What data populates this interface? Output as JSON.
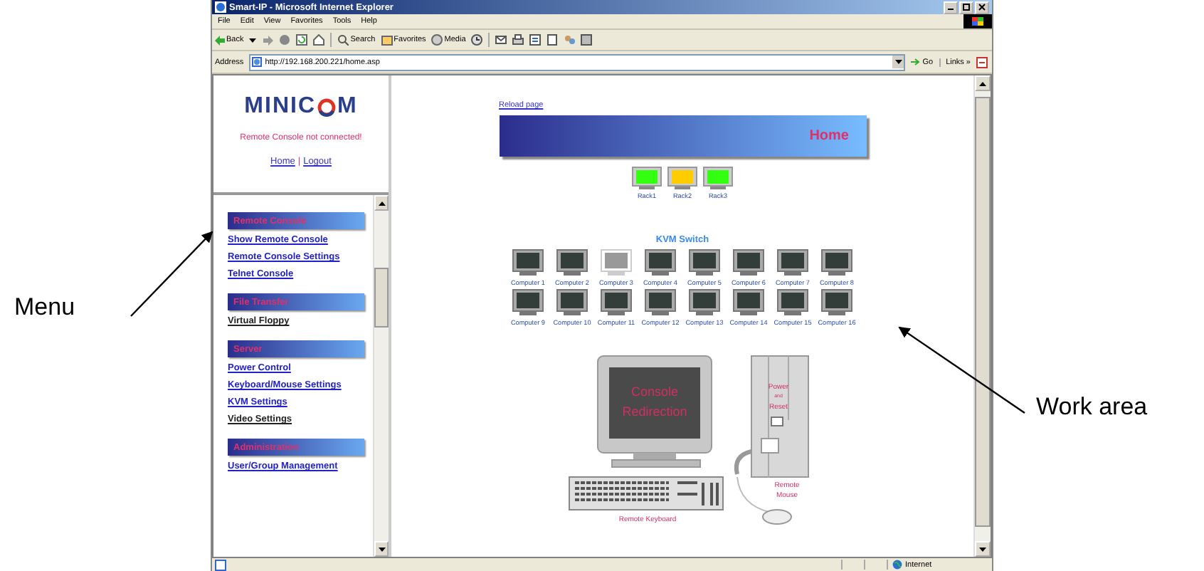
{
  "annotations": [
    {
      "text": "Menu"
    },
    {
      "text": "Work area"
    }
  ],
  "window": {
    "title": "Smart-IP - Microsoft Internet Explorer",
    "menu_bar": [
      "File",
      "Edit",
      "View",
      "Favorites",
      "Tools",
      "Help"
    ],
    "toolbar": {
      "back": "Back",
      "search": "Search",
      "favorites": "Favorites",
      "media": "Media"
    },
    "address_label": "Address",
    "url": "http://192.168.200.221/home.asp",
    "go": "Go",
    "links": "Links",
    "links_chevron": "»"
  },
  "left_frame": {
    "logo_start": "MINIC",
    "logo_end": "M",
    "connection_status": "Remote Console not connected!",
    "home_link": "Home",
    "separator": "|",
    "logout_link": "Logout",
    "sections": [
      {
        "title": "Remote Console",
        "items": [
          {
            "label": "Show Remote Console",
            "visited": false
          },
          {
            "label": "Remote Console Settings",
            "visited": false
          },
          {
            "label": "Telnet Console",
            "visited": false
          }
        ]
      },
      {
        "title": "File Transfer",
        "items": [
          {
            "label": "Virtual Floppy",
            "visited": true
          }
        ]
      },
      {
        "title": "Server",
        "items": [
          {
            "label": "Power Control",
            "visited": false
          },
          {
            "label": "Keyboard/Mouse Settings",
            "visited": false
          },
          {
            "label": "KVM Settings",
            "visited": false
          },
          {
            "label": "Video Settings",
            "visited": true
          }
        ]
      },
      {
        "title": "Administration",
        "items": [
          {
            "label": "User/Group Management",
            "visited": false
          }
        ]
      }
    ]
  },
  "work_area": {
    "reload_link": "Reload page",
    "banner_title": "Home",
    "racks": [
      {
        "label": "Rack1",
        "color": "#33ff11"
      },
      {
        "label": "Rack2",
        "color": "#ffcc00"
      },
      {
        "label": "Rack3",
        "color": "#33ff11"
      }
    ],
    "kvm_title": "KVM Switch",
    "computers": [
      {
        "label": "Computer 1",
        "selected": false
      },
      {
        "label": "Computer 2",
        "selected": false
      },
      {
        "label": "Computer 3",
        "selected": true
      },
      {
        "label": "Computer 4",
        "selected": false
      },
      {
        "label": "Computer 5",
        "selected": false
      },
      {
        "label": "Computer 6",
        "selected": false
      },
      {
        "label": "Computer 7",
        "selected": false
      },
      {
        "label": "Computer 8",
        "selected": false
      },
      {
        "label": "Computer 9",
        "selected": false
      },
      {
        "label": "Computer 10",
        "selected": false
      },
      {
        "label": "Computer 11",
        "selected": false
      },
      {
        "label": "Computer 12",
        "selected": false
      },
      {
        "label": "Computer 13",
        "selected": false
      },
      {
        "label": "Computer 14",
        "selected": false
      },
      {
        "label": "Computer 15",
        "selected": false
      },
      {
        "label": "Computer 16",
        "selected": false
      }
    ],
    "illustration": {
      "screen_line_1": "Console",
      "screen_line_2": "Redirection",
      "power_line_1": "Power",
      "power_line_2": "and",
      "power_line_3": "Reset",
      "mouse_line_1": "Remote",
      "mouse_line_2": "Mouse",
      "keyboard": "Remote Keyboard"
    }
  },
  "status_bar": {
    "zone": "Internet"
  }
}
